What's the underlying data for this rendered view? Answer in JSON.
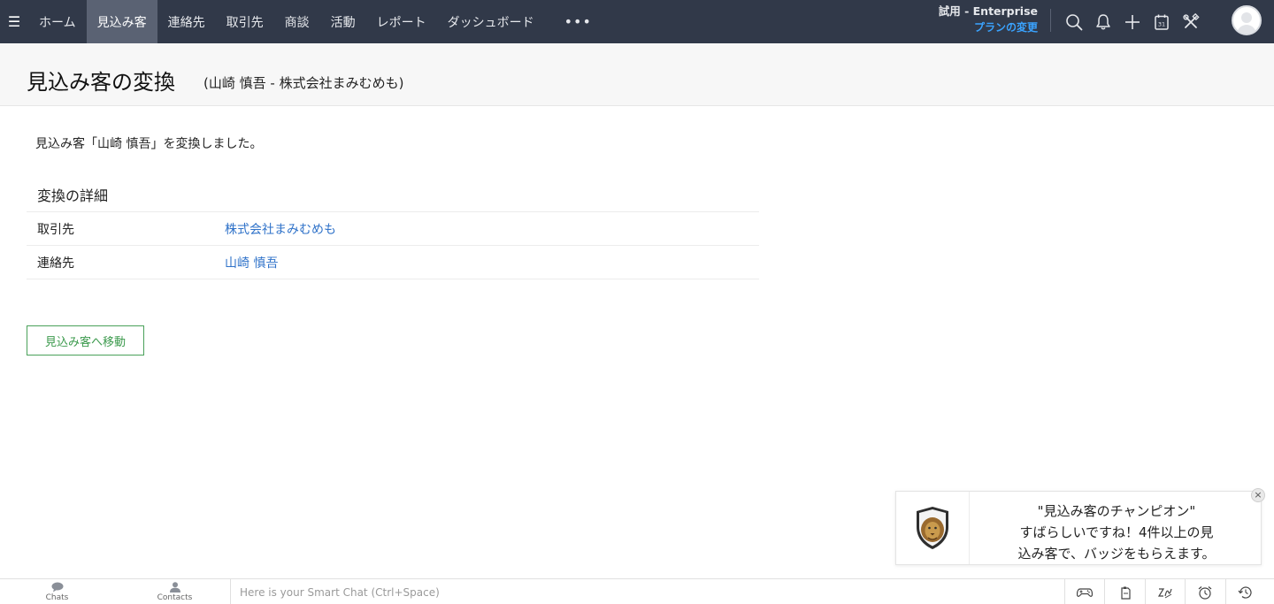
{
  "nav": {
    "tabs": [
      {
        "label": "ホーム"
      },
      {
        "label": "見込み客"
      },
      {
        "label": "連絡先"
      },
      {
        "label": "取引先"
      },
      {
        "label": "商談"
      },
      {
        "label": "活動"
      },
      {
        "label": "レポート"
      },
      {
        "label": "ダッシュボード"
      }
    ],
    "active_tab": "見込み客",
    "more_label": "•••",
    "plan_edition": "試用 - Enterprise",
    "plan_change": "プランの変更",
    "icons": [
      "search-icon",
      "bell-icon",
      "plus-icon",
      "calendar-icon",
      "tools-icon"
    ]
  },
  "header": {
    "title": "見込み客の変換",
    "subtitle": "(山崎 慎吾 - 株式会社まみむめも)"
  },
  "main": {
    "success_message": "見込み客「山崎 慎吾」を変換しました。",
    "section_title": "変換の詳細",
    "details": [
      {
        "label": "取引先",
        "value": "株式会社まみむめも"
      },
      {
        "label": "連絡先",
        "value": "山崎 慎吾"
      }
    ],
    "go_button": "見込み客へ移動"
  },
  "badge": {
    "line1": "\"見込み客のチャンピオン\"",
    "line2": "すばらしいですね！4件以上の見",
    "line3": "込み客で、バッジをもらえます。",
    "close": "×"
  },
  "bottombar": {
    "chats": "Chats",
    "contacts": "Contacts",
    "smartchat_placeholder": "Here is your Smart Chat (Ctrl+Space)"
  },
  "colors": {
    "nav_bg": "#313949",
    "link": "#2f72c9",
    "button_green": "#3c9a4d",
    "plan_link": "#3aa3ff"
  }
}
